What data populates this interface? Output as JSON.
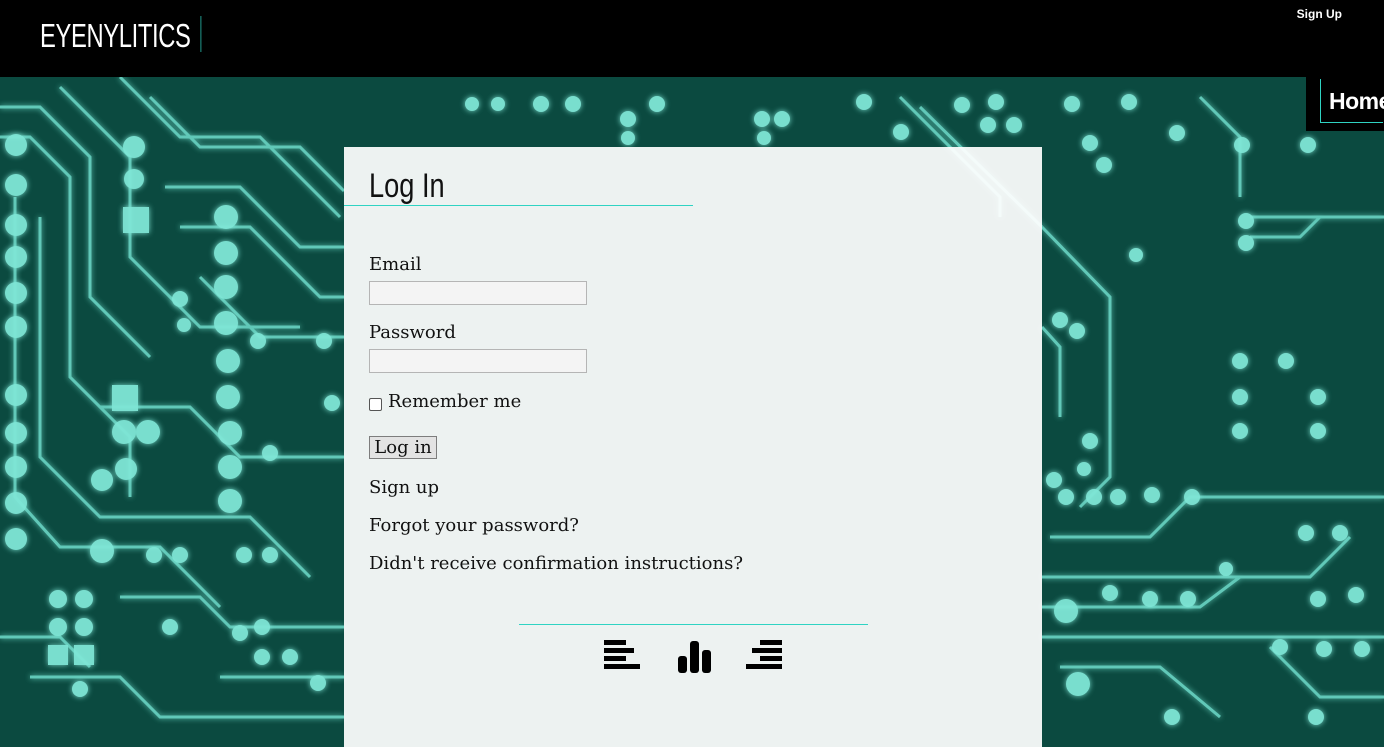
{
  "header": {
    "brand": "EYENYLITICS",
    "signup_link": "Sign Up"
  },
  "nav": {
    "home_label": "Home"
  },
  "form": {
    "title": "Log In",
    "email_label": "Email",
    "email_value": "",
    "password_label": "Password",
    "password_value": "",
    "remember_label": "Remember me",
    "remember_checked": false,
    "submit_label": "Log in"
  },
  "links": {
    "sign_up": "Sign up",
    "forgot_password": "Forgot your password?",
    "confirmation": "Didn't receive confirmation instructions?"
  },
  "footer_icons": [
    "align-left-icon",
    "bar-chart-icon",
    "align-right-icon"
  ],
  "colors": {
    "accent": "#2fd3c3",
    "circuit": "#7fe6d6",
    "background": "#0b4a40",
    "header": "#000000"
  }
}
